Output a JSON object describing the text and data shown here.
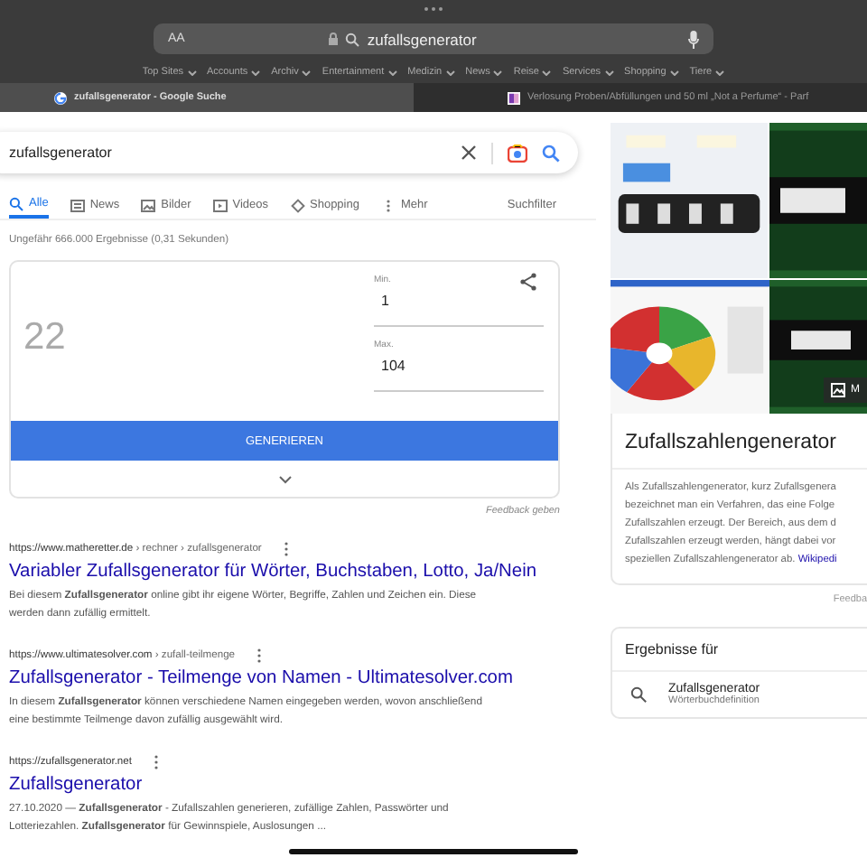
{
  "browser": {
    "text_size": "AA",
    "address": "zufallsgenerator",
    "bookmarks": [
      "Top Sites",
      "Accounts",
      "Archiv",
      "Entertainment",
      "Medizin",
      "News",
      "Reise",
      "Services",
      "Shopping",
      "Tiere"
    ],
    "tabs": [
      {
        "title": "zufallsgenerator - Google Suche",
        "selected": true
      },
      {
        "title": "Verlosung Proben/Abfüllungen und 50 ml „Not a Perfume“ - Parf",
        "selected": false
      }
    ]
  },
  "search": {
    "query": "zufallsgenerator"
  },
  "filters": [
    {
      "label": "Alle",
      "selected": true
    },
    {
      "label": "News",
      "selected": false
    },
    {
      "label": "Bilder",
      "selected": false
    },
    {
      "label": "Videos",
      "selected": false
    },
    {
      "label": "Shopping",
      "selected": false
    },
    {
      "label": "Mehr",
      "selected": false
    }
  ],
  "tools": "Suchfilter",
  "result_stats": "Ungefähr 666.000 Ergebnisse (0,31 Sekunden)",
  "generator": {
    "result": "22",
    "min_label": "Min.",
    "min": "1",
    "max_label": "Max.",
    "max": "104",
    "button": "GENERIEREN",
    "feedback": "Feedback geben"
  },
  "results": [
    {
      "url": "https://www.matheretter.de",
      "path": " › rechner › zufallsgenerator",
      "title": "Variabler Zufallsgenerator für Wörter, Buchstaben, Lotto, Ja/Nein",
      "snippet": "Bei diesem **Zufallsgenerator** online gibt ihr eigene Wörter, Begriffe, Zahlen und Zeichen ein. Diese werden dann zufällig ermittelt."
    },
    {
      "url": "https://www.ultimatesolver.com",
      "path": " › zufall-teilmenge",
      "title": "Zufallsgenerator - Teilmenge von Namen - Ultimatesolver.com",
      "snippet": "In diesem **Zufallsgenerator** können verschiedene Namen eingegeben werden, wovon anschließend eine bestimmte Teilmenge davon zufällig ausgewählt wird."
    },
    {
      "url": "https://zufallsgenerator.net",
      "title": "Zufallsgenerator",
      "snippet": "27.10.2020 — **Zufallsgenerator** - Zufallszahlen generieren, zufällige Zahlen, Passwörter und Lotteriezahlen. **Zufallsgenerator** für Gewinnspiele, Auslosungen ..."
    }
  ],
  "knowledge_panel": {
    "more_images": "M",
    "title": "Zufallszahlengenerator",
    "description_lines": [
      "Als Zufallszahlengenerator, kurz Zufallsgenera",
      "bezeichnet man ein Verfahren, das eine Folge",
      "Zufallszahlen erzeugt. Der Bereich, aus dem d",
      "Zufallszahlen erzeugt werden, hängt dabei vor"
    ],
    "description_end": "speziellen Zufallszahlengenerator ab.",
    "source": "Wikipedi",
    "feedback": "Feedba"
  },
  "related": {
    "heading": "Ergebnisse für",
    "item": {
      "title": "Zufallsgenerator",
      "subtitle": "Wörterbuchdefinition"
    }
  }
}
